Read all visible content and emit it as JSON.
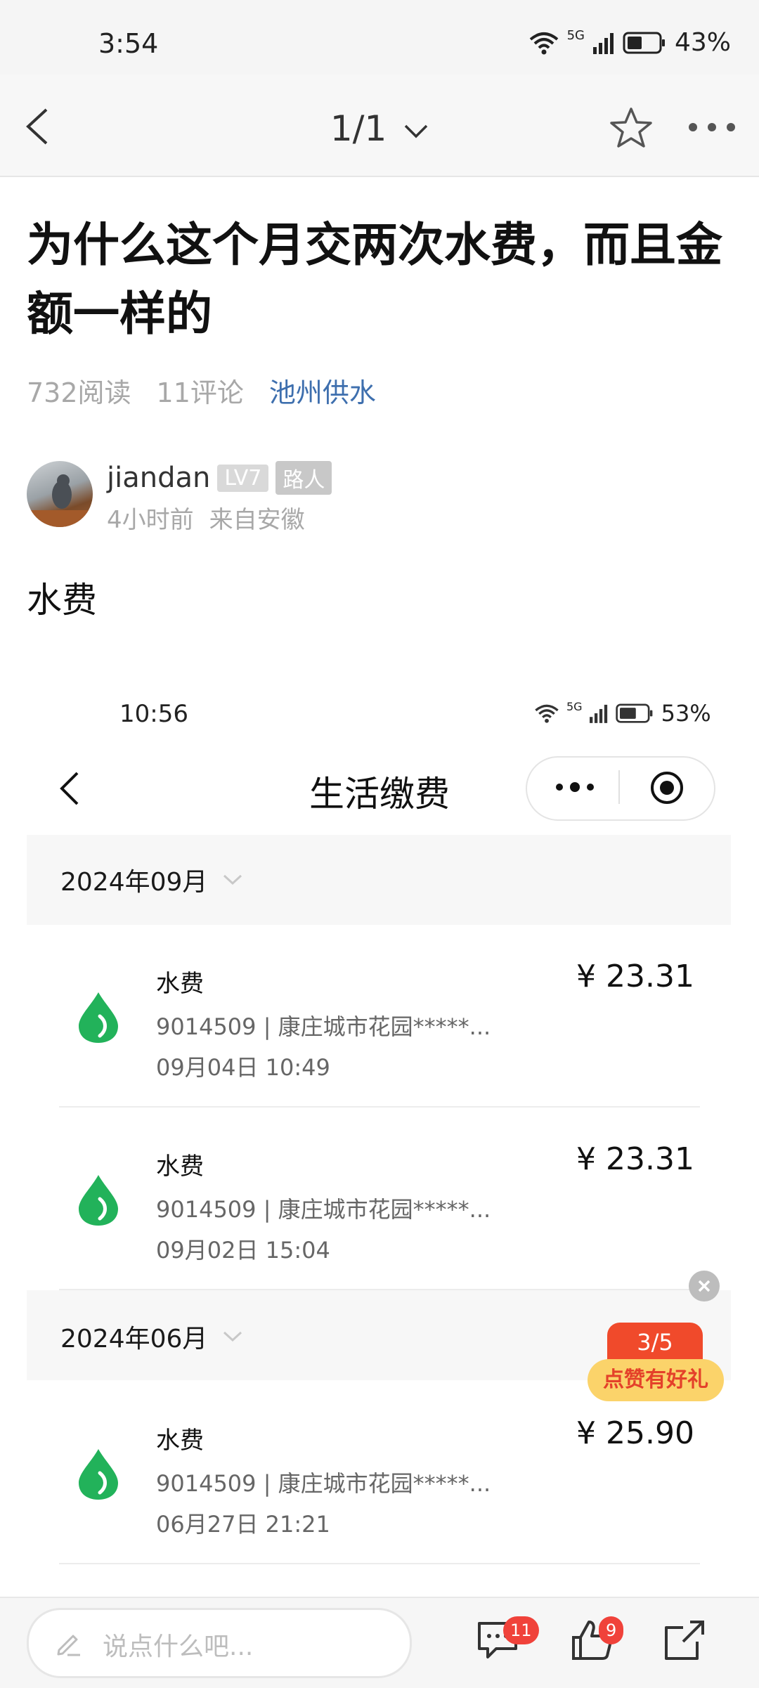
{
  "status_bar": {
    "time": "3:54",
    "network": "5G",
    "battery": "43%"
  },
  "navbar": {
    "page_indicator": "1/1"
  },
  "article": {
    "title": "为什么这个月交两次水费，而且金额一样的",
    "reads": "732阅读",
    "comments": "11评论",
    "topic": "池州供水",
    "author": {
      "name": "jiandan",
      "level": "LV7",
      "role": "路人",
      "time": "4小时前",
      "location": "来自安徽"
    },
    "body": "水费"
  },
  "embedded": {
    "status_time": "10:56",
    "status_network": "5G",
    "status_battery": "53%",
    "title": "生活缴费",
    "groups": [
      {
        "month": "2024年09月",
        "records": [
          {
            "name": "水费",
            "detail": "9014509 | 康庄城市花园*****...",
            "date": "09月04日 10:49",
            "amount": "¥ 23.31"
          },
          {
            "name": "水费",
            "detail": "9014509 | 康庄城市花园*****...",
            "date": "09月02日 15:04",
            "amount": "¥ 23.31"
          }
        ]
      },
      {
        "month": "2024年06月",
        "records": [
          {
            "name": "水费",
            "detail": "9014509 | 康庄城市花园*****...",
            "date": "06月27日 21:21",
            "amount": "¥ 25.90"
          }
        ]
      }
    ]
  },
  "promo": {
    "progress": "3/5",
    "label": "点赞有好礼"
  },
  "bottom_bar": {
    "input_placeholder": "说点什么吧...",
    "comment_count": "11",
    "like_count": "9"
  },
  "colors": {
    "topic_link": "#3e6fae",
    "water_icon": "#22b25a",
    "badge_red": "#f0423a"
  }
}
